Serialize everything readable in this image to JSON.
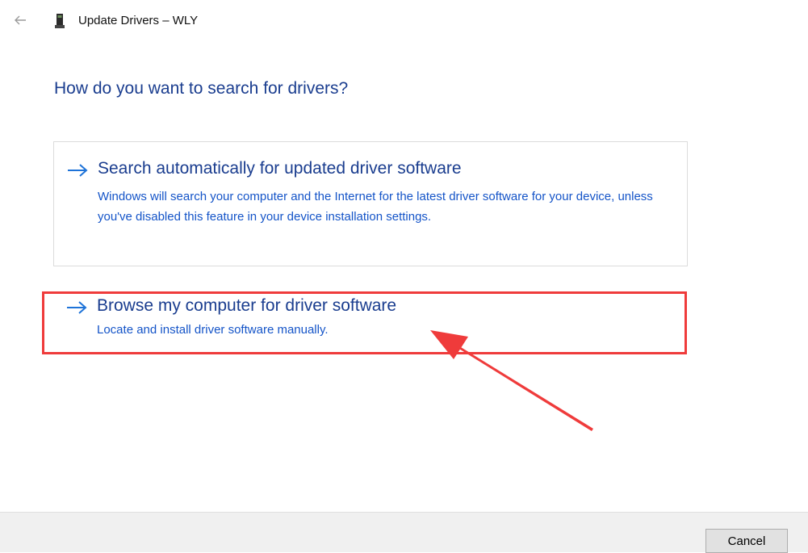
{
  "window": {
    "title": "Update Drivers – WLY",
    "back_icon": "back-arrow-icon",
    "device_icon": "device-icon"
  },
  "heading": "How do you want to search for drivers?",
  "options": [
    {
      "title": "Search automatically for updated driver software",
      "description": "Windows will search your computer and the Internet for the latest driver software for your device, unless you've disabled this feature in your device installation settings.",
      "icon": "right-arrow-icon"
    },
    {
      "title": "Browse my computer for driver software",
      "description": "Locate and install driver software manually.",
      "icon": "right-arrow-icon",
      "highlighted": true
    }
  ],
  "footer": {
    "cancel_label": "Cancel"
  },
  "colors": {
    "heading": "#1a3d8f",
    "link_text": "#1454c8",
    "arrow": "#1e73d8",
    "annotation": "#ef3b3b",
    "footer_bg": "#f0f0f0"
  }
}
